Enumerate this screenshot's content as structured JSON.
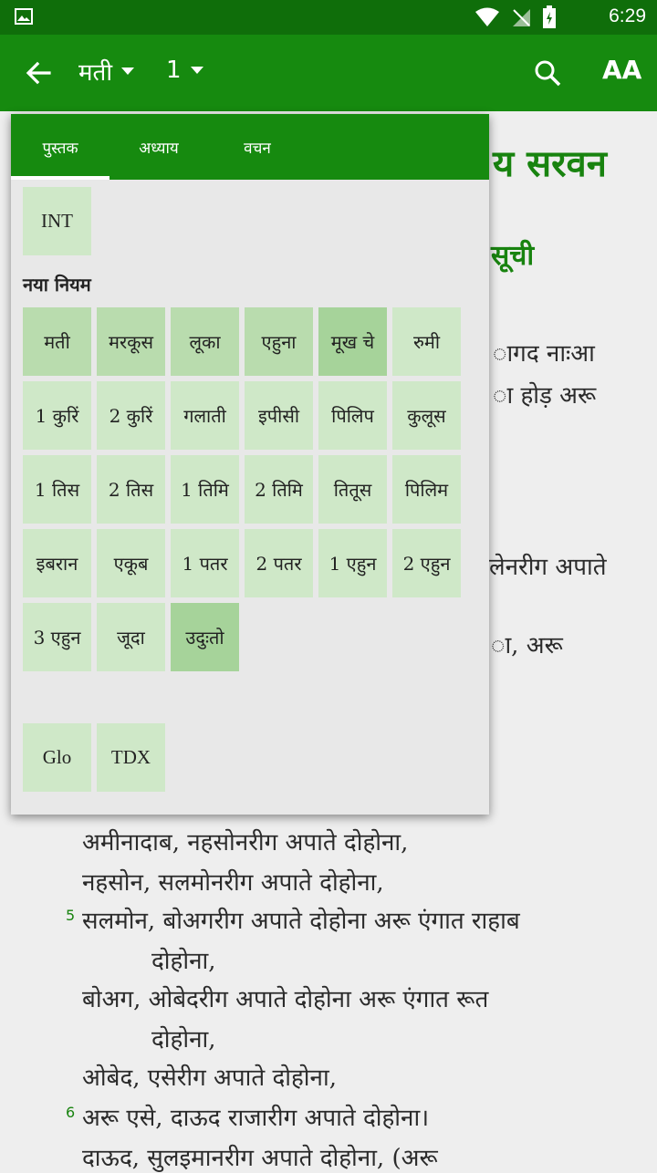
{
  "status": {
    "time": "6:29"
  },
  "toolbar": {
    "book": "मती",
    "chapter": "1",
    "text_size_label": "AA"
  },
  "reading": {
    "heading": "य सरवन",
    "sub": "सूची",
    "lines": [
      "ागद नाःआ",
      "ा होड़ अरू",
      "लेनरीग अपाते",
      "ा, अरू",
      "अमीनादाब, नहसोनरीग अपाते दोहोना,",
      "नहसोन, सलमोनरीग अपाते दोहोना,",
      "सलमोन, बोअगरीग अपाते दोहोना अरू एंगात राहाब",
      "दोहोना,",
      "बोअग, ओबेदरीग अपाते दोहोना अरू एंगात रूत",
      "दोहोना,",
      "ओबेद, एसेरीग अपाते दोहोना,",
      "अरू एसे, दाऊद राजारीग अपाते दोहोना।",
      "दाऊद, सुलइमानरीग अपाते दोहोना, (अरू"
    ],
    "verse_5": "5",
    "verse_6": "6"
  },
  "popup": {
    "tabs": [
      "पुस्तक",
      "अध्याय",
      "वचन"
    ],
    "intro": "INT",
    "section_label": "नया नियम",
    "books": [
      "मती",
      "मरकूस",
      "लूका",
      "एहुना",
      "मूख चे",
      "रुमी",
      "1 कुरिं",
      "2 कुरिं",
      "गलाती",
      "इपीसी",
      "पिलिप",
      "कुलूस",
      "1 तिस",
      "2 तिस",
      "1 तिमि",
      "2 तिमि",
      "तितूस",
      "पिलिम",
      "इबरान",
      "एकूब",
      "1 पतर",
      "2 पतर",
      "1 एहुन",
      "2 एहुन",
      "3 एहुन",
      "जूदा",
      "उदुःतो"
    ],
    "extras": [
      "Glo",
      "TDX"
    ]
  }
}
